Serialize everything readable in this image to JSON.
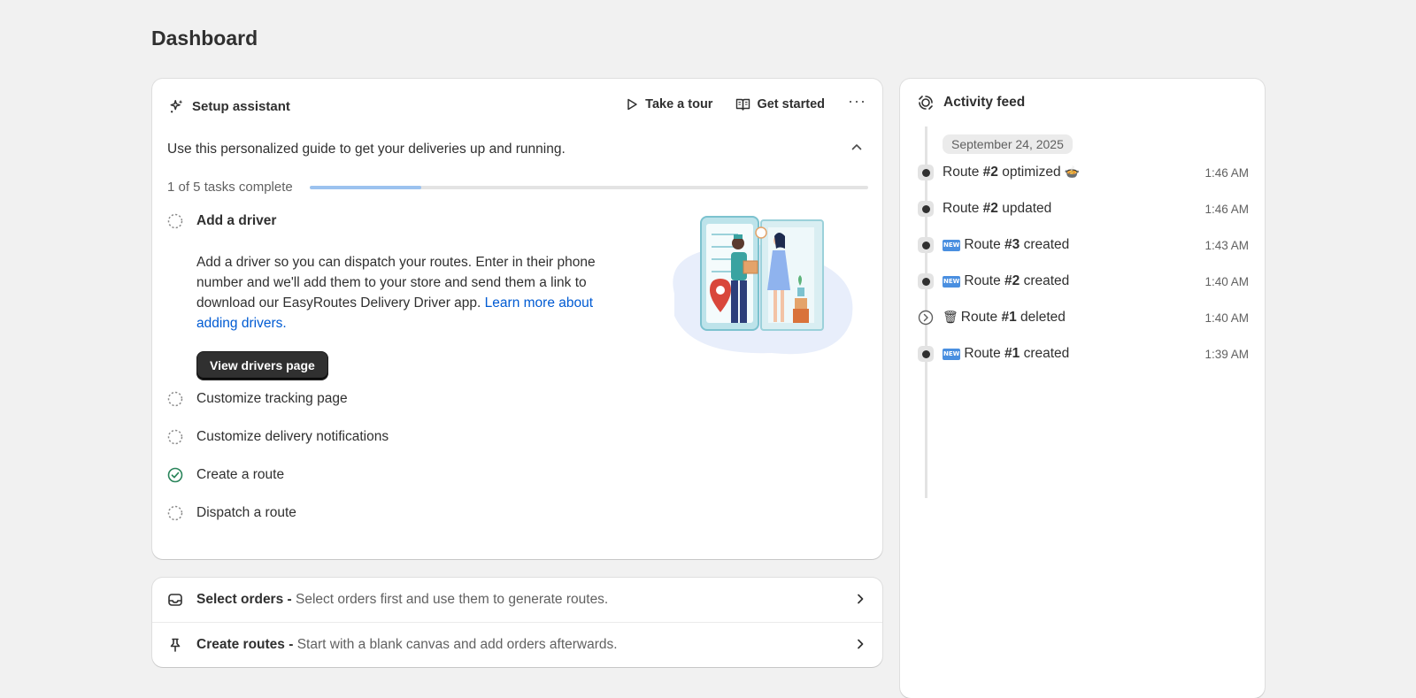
{
  "page": {
    "title": "Dashboard"
  },
  "setup": {
    "title": "Setup assistant",
    "take_tour_label": "Take a tour",
    "get_started_label": "Get started",
    "more_label": "···",
    "guide_text": "Use this personalized guide to get your deliveries up and running.",
    "progress_text": "1 of 5 tasks complete",
    "progress_fraction": 0.2,
    "tasks": [
      {
        "label": "Add a driver",
        "status": "incomplete",
        "expanded": true,
        "description": "Add a driver so you can dispatch your routes. Enter in their phone number and we'll add them to your store and send them a link to download our EasyRoutes Delivery Driver app.",
        "link_text": "Learn more about adding drivers.",
        "button_label": "View drivers page"
      },
      {
        "label": "Customize tracking page",
        "status": "incomplete"
      },
      {
        "label": "Customize delivery notifications",
        "status": "incomplete"
      },
      {
        "label": "Create a route",
        "status": "complete"
      },
      {
        "label": "Dispatch a route",
        "status": "incomplete"
      }
    ]
  },
  "actions": [
    {
      "title": "Select orders -",
      "subtitle": " Select orders first and use them to generate routes.",
      "icon": "inbox-icon"
    },
    {
      "title": "Create routes -",
      "subtitle": " Start with a blank canvas and add orders afterwards.",
      "icon": "pin-icon"
    }
  ],
  "activity": {
    "title": "Activity feed",
    "date": "September 24, 2025",
    "items": [
      {
        "prefix": "Route ",
        "bold": "#2",
        "suffix": " optimized",
        "emoji": "🍲",
        "emoji_pos": "after",
        "time": "1:46 AM",
        "marker": "dot"
      },
      {
        "prefix": "Route ",
        "bold": "#2",
        "suffix": " updated",
        "emoji": "",
        "time": "1:46 AM",
        "marker": "dot"
      },
      {
        "prefix": "Route ",
        "bold": "#3",
        "suffix": " created",
        "emoji": "NEW",
        "emoji_pos": "before",
        "time": "1:43 AM",
        "marker": "dot"
      },
      {
        "prefix": "Route ",
        "bold": "#2",
        "suffix": " created",
        "emoji": "NEW",
        "emoji_pos": "before",
        "time": "1:40 AM",
        "marker": "dot"
      },
      {
        "prefix": "Route ",
        "bold": "#1",
        "suffix": " deleted",
        "emoji": "🗑",
        "emoji_pos": "before",
        "time": "1:40 AM",
        "marker": "chevron"
      },
      {
        "prefix": "Route ",
        "bold": "#1",
        "suffix": " created",
        "emoji": "NEW",
        "emoji_pos": "before",
        "time": "1:39 AM",
        "marker": "dot"
      }
    ]
  },
  "colors": {
    "link": "#005bd3",
    "progress_fill": "#9bc2ef",
    "complete_check": "#29845a",
    "primary_button": "#303030"
  }
}
